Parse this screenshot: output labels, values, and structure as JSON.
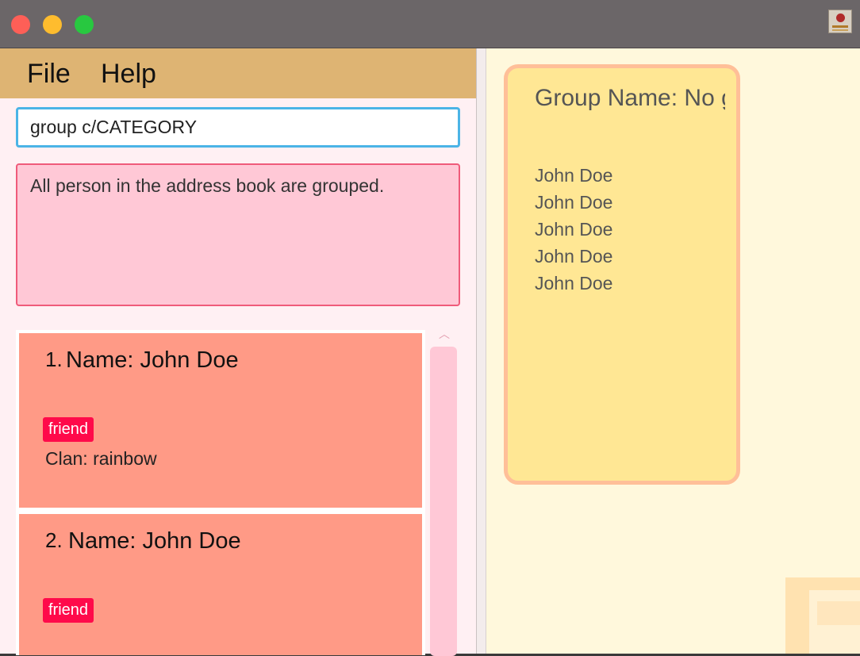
{
  "window": {
    "controls": [
      "close",
      "minimize",
      "maximize"
    ],
    "app_icon": "app-logo-icon"
  },
  "menu": {
    "file_label": "File",
    "help_label": "Help"
  },
  "command": {
    "value": "group c/CATEGORY"
  },
  "result": {
    "message": "All person in the address book are grouped."
  },
  "person_list": [
    {
      "index": "1.",
      "name": "Name: John Doe",
      "tag": "friend",
      "clan": "Clan: rainbow"
    },
    {
      "index": "2.",
      "name": "Name: John Doe",
      "tag": "friend"
    }
  ],
  "group_panel": {
    "group_name": "Group Name: No group",
    "members": [
      "John Doe",
      "John Doe",
      "John Doe",
      "John Doe",
      "John Doe"
    ]
  },
  "colors": {
    "menubar": "#deb473",
    "command_border": "#4bb4e6",
    "result_bg": "#ffc8d6",
    "person_card": "#ff9a86",
    "tag": "#ff0a4a",
    "group_card": "#ffe794",
    "right_pane": "#fff8dc"
  }
}
